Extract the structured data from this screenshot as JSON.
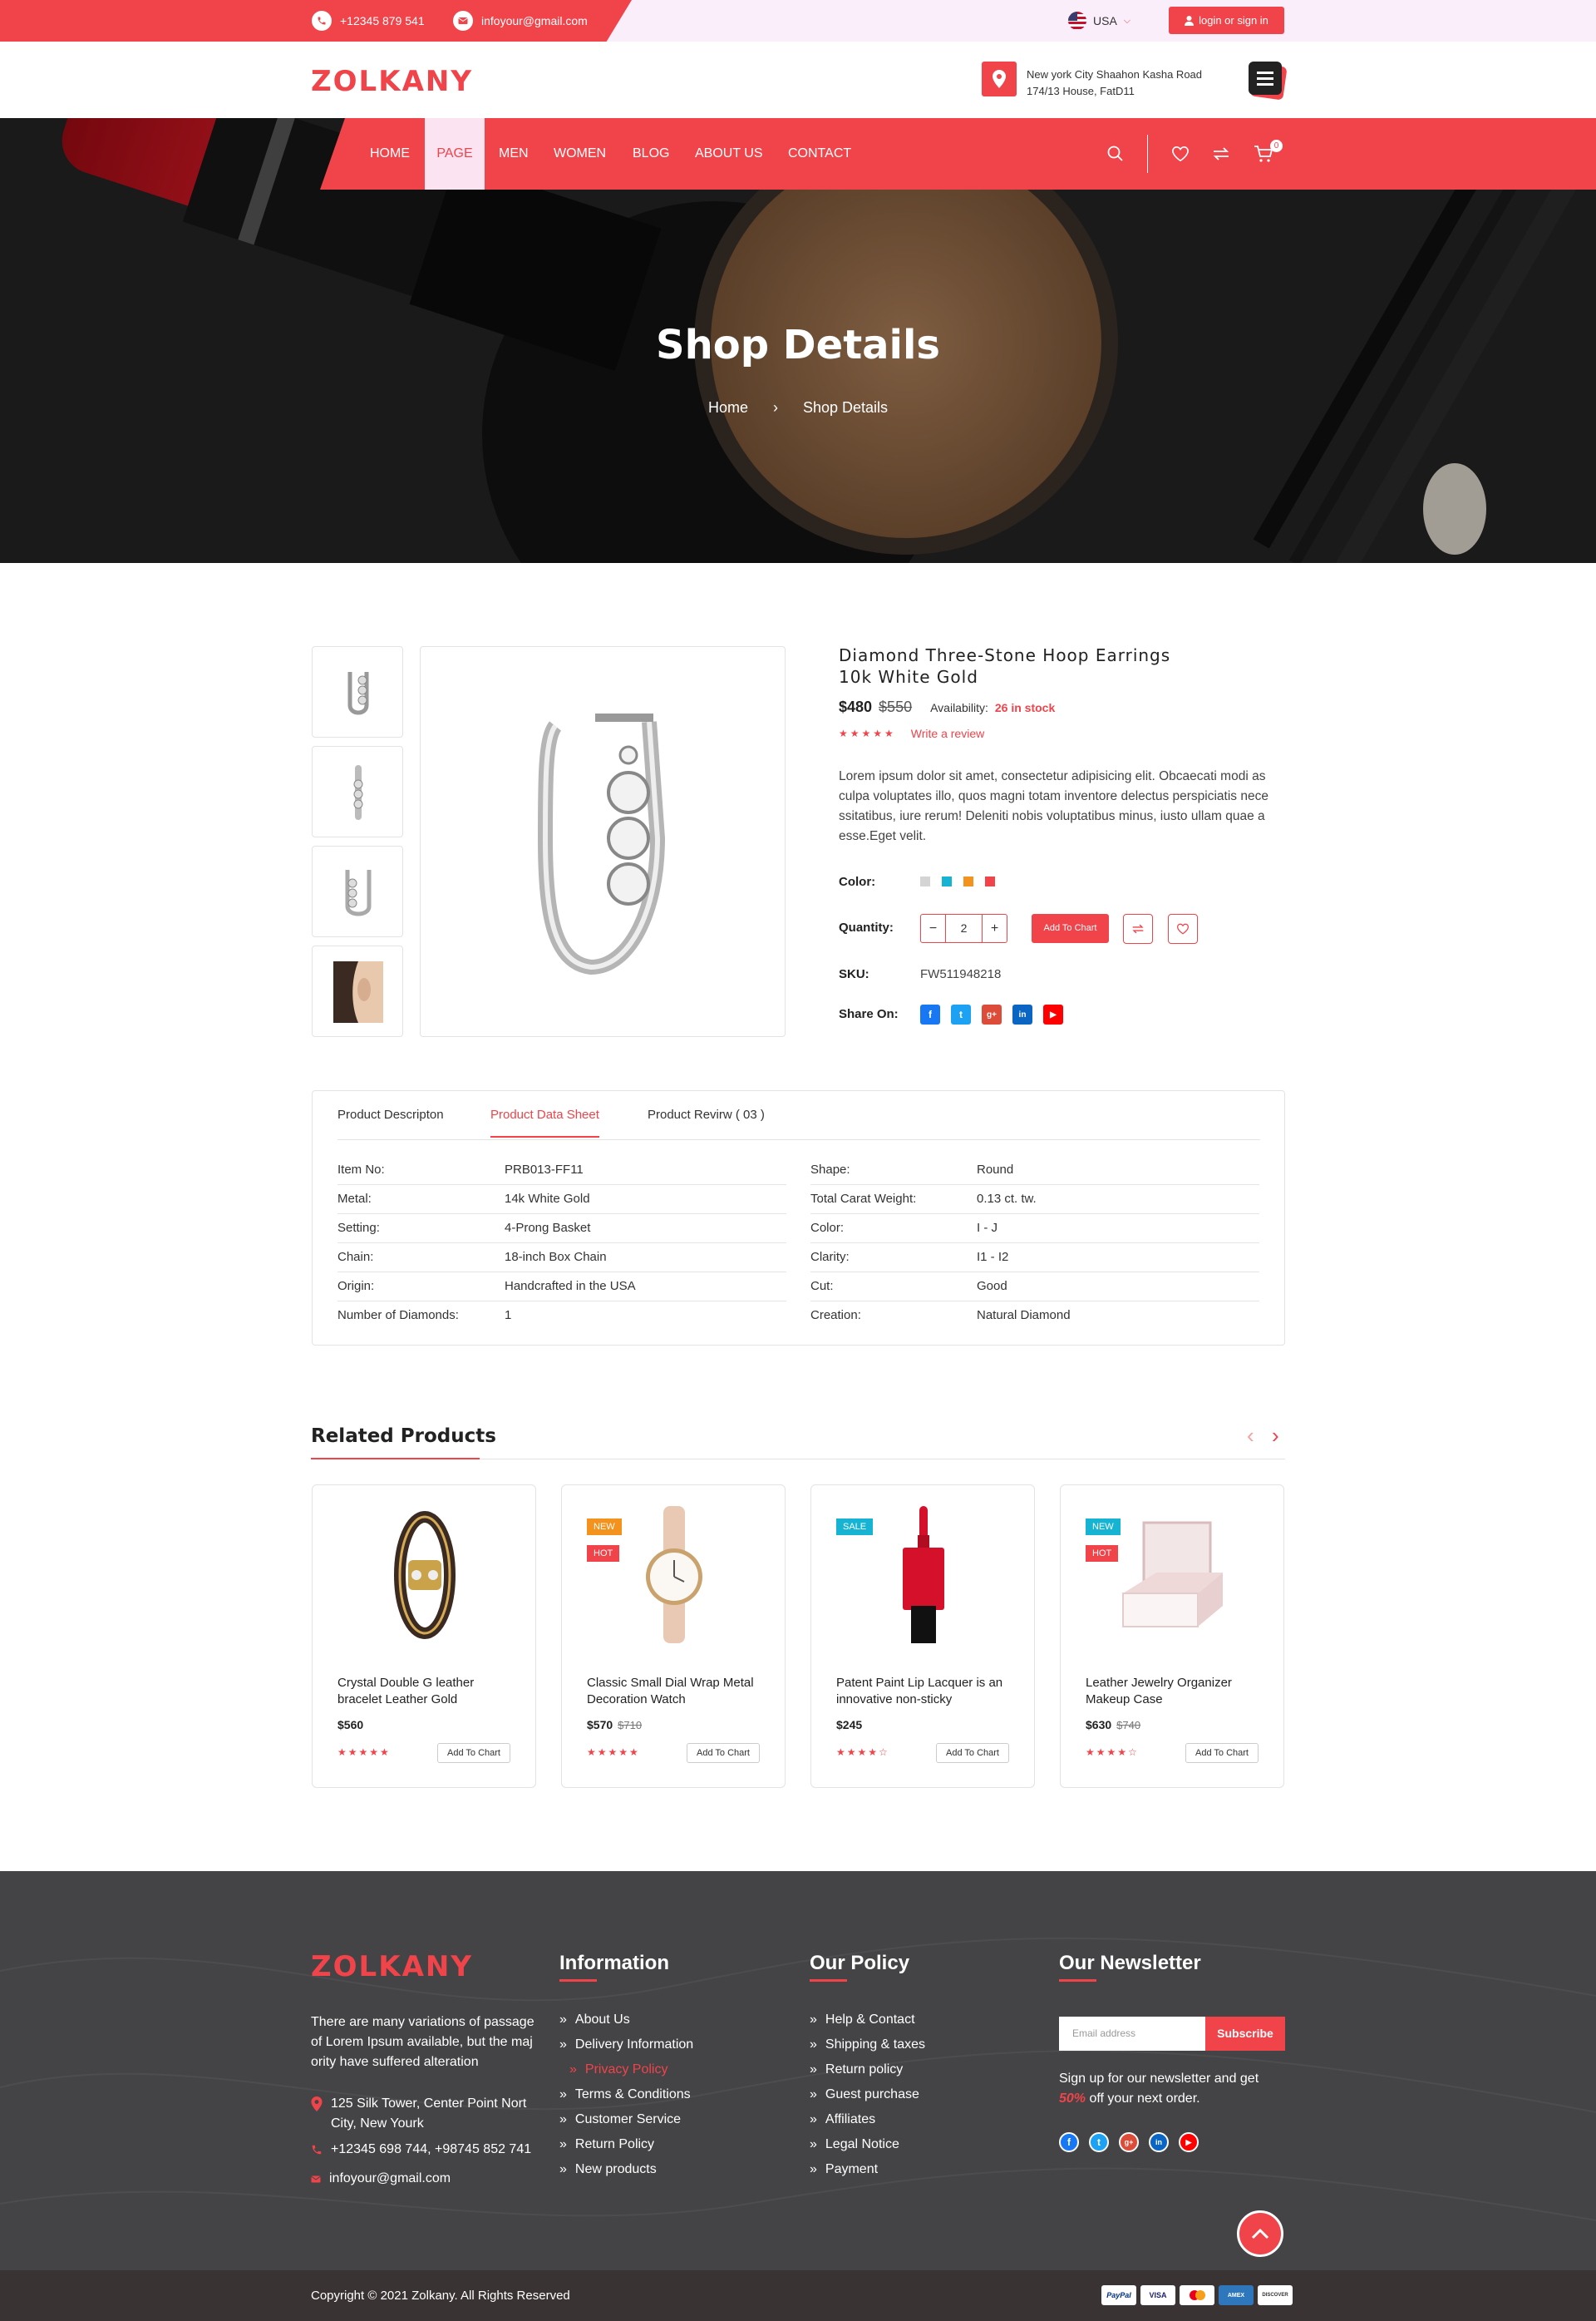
{
  "topbar": {
    "phone": "+12345 879 541",
    "email": "infoyour@gmail.com",
    "country": "USA",
    "login_label": "login or sign in"
  },
  "header": {
    "logo": "ZOLKANY",
    "address_line1": "New york City Shaahon Kasha Road",
    "address_line2": "174/13 House, FatD11"
  },
  "nav": {
    "items": [
      "HOME",
      "PAGE",
      "MEN",
      "WOMEN",
      "BLOG",
      "ABOUT US",
      "CONTACT"
    ],
    "active": "PAGE",
    "cart_count": "0"
  },
  "hero": {
    "title": "Shop Details",
    "breadcrumb_home": "Home",
    "breadcrumb_current": "Shop Details"
  },
  "product": {
    "title_line1": "Diamond Three-Stone Hoop Earrings",
    "title_line2": "10k White Gold",
    "price": "$480",
    "old_price": "$550",
    "availability_label": "Availability:",
    "availability_value": "26 in stock",
    "rating": 5,
    "review_link": "Write a review",
    "description": "Lorem ipsum dolor sit amet, consectetur adipisicing elit. Obcaecati modi as culpa voluptates illo, quos magni totam inventore delectus perspiciatis nece ssitatibus, iure rerum! Deleniti nobis voluptatibus minus, iusto ullam quae a esse.Eget velit.",
    "color_label": "Color:",
    "colors": [
      "#d4d4d4",
      "#17b3d3",
      "#f3921d",
      "#f0434a"
    ],
    "quantity_label": "Quantity:",
    "quantity": "2",
    "add_to_cart": "Add To Chart",
    "sku_label": "SKU:",
    "sku": "FW511948218",
    "share_label": "Share On:"
  },
  "tabs": {
    "items": [
      "Product Descripton",
      "Product Data Sheet",
      "Product Revirw ( 03 )"
    ],
    "active": "Product Data Sheet"
  },
  "specs": {
    "left": [
      {
        "k": "Item No:",
        "v": "PRB013-FF11"
      },
      {
        "k": "Metal:",
        "v": "14k White Gold"
      },
      {
        "k": "Setting:",
        "v": "4-Prong Basket"
      },
      {
        "k": "Chain:",
        "v": "18-inch Box Chain"
      },
      {
        "k": "Origin:",
        "v": "Handcrafted in the USA"
      },
      {
        "k": "Number of Diamonds:",
        "v": "1"
      }
    ],
    "right": [
      {
        "k": "Shape:",
        "v": "Round"
      },
      {
        "k": "Total Carat Weight:",
        "v": "0.13 ct. tw."
      },
      {
        "k": "Color:",
        "v": "I - J"
      },
      {
        "k": "Clarity:",
        "v": "I1 - I2"
      },
      {
        "k": "Cut:",
        "v": "Good"
      },
      {
        "k": "Creation:",
        "v": "Natural Diamond"
      }
    ]
  },
  "related": {
    "heading": "Related Products",
    "products": [
      {
        "title": "Crystal Double G leather bracelet Leather Gold",
        "price": "$560",
        "old_price": "",
        "rating": 5,
        "badges": [],
        "btn": "Add To Chart"
      },
      {
        "title": "Classic Small Dial Wrap Metal Decoration Watch",
        "price": "$570",
        "old_price": "$710",
        "rating": 5,
        "badges": [
          "NEW",
          "HOT"
        ],
        "btn": "Add To Chart"
      },
      {
        "title": "Patent Paint Lip Lacquer is an innovative non-sticky",
        "price": "$245",
        "old_price": "",
        "rating": 4.5,
        "badges": [
          "SALE"
        ],
        "btn": "Add To Chart"
      },
      {
        "title": "Leather Jewelry Organizer Makeup Case",
        "price": "$630",
        "old_price": "$740",
        "rating": 4.5,
        "badges": [
          "NEW",
          "HOT"
        ],
        "btn": "Add To Chart"
      }
    ]
  },
  "footer": {
    "logo": "ZOLKANY",
    "about": [
      "There are many variations of passage",
      "of Lorem Ipsum available, but the maj",
      "ority have suffered alteration"
    ],
    "address_line1": "125 Silk Tower, Center Point Nort",
    "address_line2": "City, New Yourk",
    "phones": "+12345 698 744, +98745 852 741",
    "email": "infoyour@gmail.com",
    "info_heading": "Information",
    "info_links": [
      "About Us",
      "Delivery Information",
      "Privacy Policy",
      "Terms & Conditions",
      "Customer Service",
      "Return Policy",
      "New products"
    ],
    "info_active": "Privacy Policy",
    "policy_heading": "Our Policy",
    "policy_links": [
      "Help & Contact",
      "Shipping & taxes",
      "Return policy",
      "Guest purchase",
      "Affiliates",
      "Legal Notice",
      "Payment"
    ],
    "newsletter_heading": "Our Newsletter",
    "newsletter_placeholder": "Email address",
    "subscribe": "Subscribe",
    "newsletter_text1": "Sign up for our newsletter and get",
    "newsletter_pct": "50%",
    "newsletter_text2": " off your next order.",
    "copyright": "Copyright © 2021 Zolkany. All Rights Reserved",
    "payments": [
      "PayPal",
      "VISA",
      "MC",
      "AMEX",
      "DISCOVER"
    ]
  },
  "colors": {
    "accent": "#f0434a",
    "footer_bg": "#444446"
  }
}
